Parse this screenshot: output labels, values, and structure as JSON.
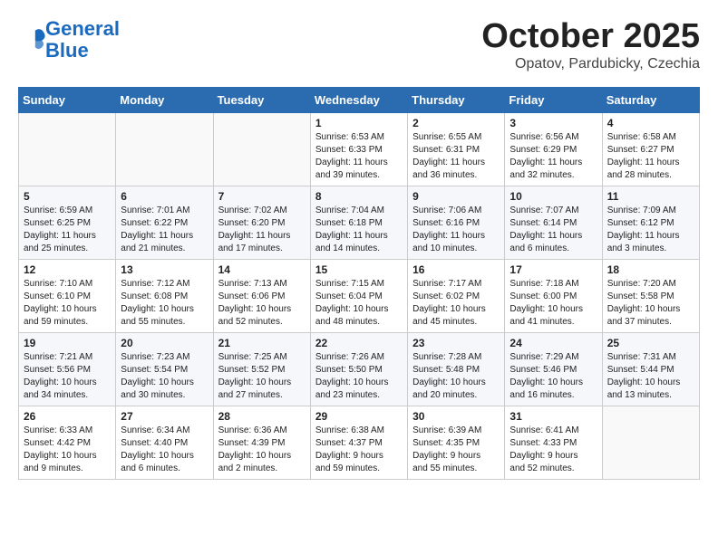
{
  "header": {
    "logo_line1": "General",
    "logo_line2": "Blue",
    "month": "October 2025",
    "location": "Opatov, Pardubicky, Czechia"
  },
  "weekdays": [
    "Sunday",
    "Monday",
    "Tuesday",
    "Wednesday",
    "Thursday",
    "Friday",
    "Saturday"
  ],
  "weeks": [
    [
      {
        "day": "",
        "info": ""
      },
      {
        "day": "",
        "info": ""
      },
      {
        "day": "",
        "info": ""
      },
      {
        "day": "1",
        "info": "Sunrise: 6:53 AM\nSunset: 6:33 PM\nDaylight: 11 hours\nand 39 minutes."
      },
      {
        "day": "2",
        "info": "Sunrise: 6:55 AM\nSunset: 6:31 PM\nDaylight: 11 hours\nand 36 minutes."
      },
      {
        "day": "3",
        "info": "Sunrise: 6:56 AM\nSunset: 6:29 PM\nDaylight: 11 hours\nand 32 minutes."
      },
      {
        "day": "4",
        "info": "Sunrise: 6:58 AM\nSunset: 6:27 PM\nDaylight: 11 hours\nand 28 minutes."
      }
    ],
    [
      {
        "day": "5",
        "info": "Sunrise: 6:59 AM\nSunset: 6:25 PM\nDaylight: 11 hours\nand 25 minutes."
      },
      {
        "day": "6",
        "info": "Sunrise: 7:01 AM\nSunset: 6:22 PM\nDaylight: 11 hours\nand 21 minutes."
      },
      {
        "day": "7",
        "info": "Sunrise: 7:02 AM\nSunset: 6:20 PM\nDaylight: 11 hours\nand 17 minutes."
      },
      {
        "day": "8",
        "info": "Sunrise: 7:04 AM\nSunset: 6:18 PM\nDaylight: 11 hours\nand 14 minutes."
      },
      {
        "day": "9",
        "info": "Sunrise: 7:06 AM\nSunset: 6:16 PM\nDaylight: 11 hours\nand 10 minutes."
      },
      {
        "day": "10",
        "info": "Sunrise: 7:07 AM\nSunset: 6:14 PM\nDaylight: 11 hours\nand 6 minutes."
      },
      {
        "day": "11",
        "info": "Sunrise: 7:09 AM\nSunset: 6:12 PM\nDaylight: 11 hours\nand 3 minutes."
      }
    ],
    [
      {
        "day": "12",
        "info": "Sunrise: 7:10 AM\nSunset: 6:10 PM\nDaylight: 10 hours\nand 59 minutes."
      },
      {
        "day": "13",
        "info": "Sunrise: 7:12 AM\nSunset: 6:08 PM\nDaylight: 10 hours\nand 55 minutes."
      },
      {
        "day": "14",
        "info": "Sunrise: 7:13 AM\nSunset: 6:06 PM\nDaylight: 10 hours\nand 52 minutes."
      },
      {
        "day": "15",
        "info": "Sunrise: 7:15 AM\nSunset: 6:04 PM\nDaylight: 10 hours\nand 48 minutes."
      },
      {
        "day": "16",
        "info": "Sunrise: 7:17 AM\nSunset: 6:02 PM\nDaylight: 10 hours\nand 45 minutes."
      },
      {
        "day": "17",
        "info": "Sunrise: 7:18 AM\nSunset: 6:00 PM\nDaylight: 10 hours\nand 41 minutes."
      },
      {
        "day": "18",
        "info": "Sunrise: 7:20 AM\nSunset: 5:58 PM\nDaylight: 10 hours\nand 37 minutes."
      }
    ],
    [
      {
        "day": "19",
        "info": "Sunrise: 7:21 AM\nSunset: 5:56 PM\nDaylight: 10 hours\nand 34 minutes."
      },
      {
        "day": "20",
        "info": "Sunrise: 7:23 AM\nSunset: 5:54 PM\nDaylight: 10 hours\nand 30 minutes."
      },
      {
        "day": "21",
        "info": "Sunrise: 7:25 AM\nSunset: 5:52 PM\nDaylight: 10 hours\nand 27 minutes."
      },
      {
        "day": "22",
        "info": "Sunrise: 7:26 AM\nSunset: 5:50 PM\nDaylight: 10 hours\nand 23 minutes."
      },
      {
        "day": "23",
        "info": "Sunrise: 7:28 AM\nSunset: 5:48 PM\nDaylight: 10 hours\nand 20 minutes."
      },
      {
        "day": "24",
        "info": "Sunrise: 7:29 AM\nSunset: 5:46 PM\nDaylight: 10 hours\nand 16 minutes."
      },
      {
        "day": "25",
        "info": "Sunrise: 7:31 AM\nSunset: 5:44 PM\nDaylight: 10 hours\nand 13 minutes."
      }
    ],
    [
      {
        "day": "26",
        "info": "Sunrise: 6:33 AM\nSunset: 4:42 PM\nDaylight: 10 hours\nand 9 minutes."
      },
      {
        "day": "27",
        "info": "Sunrise: 6:34 AM\nSunset: 4:40 PM\nDaylight: 10 hours\nand 6 minutes."
      },
      {
        "day": "28",
        "info": "Sunrise: 6:36 AM\nSunset: 4:39 PM\nDaylight: 10 hours\nand 2 minutes."
      },
      {
        "day": "29",
        "info": "Sunrise: 6:38 AM\nSunset: 4:37 PM\nDaylight: 9 hours\nand 59 minutes."
      },
      {
        "day": "30",
        "info": "Sunrise: 6:39 AM\nSunset: 4:35 PM\nDaylight: 9 hours\nand 55 minutes."
      },
      {
        "day": "31",
        "info": "Sunrise: 6:41 AM\nSunset: 4:33 PM\nDaylight: 9 hours\nand 52 minutes."
      },
      {
        "day": "",
        "info": ""
      }
    ]
  ]
}
